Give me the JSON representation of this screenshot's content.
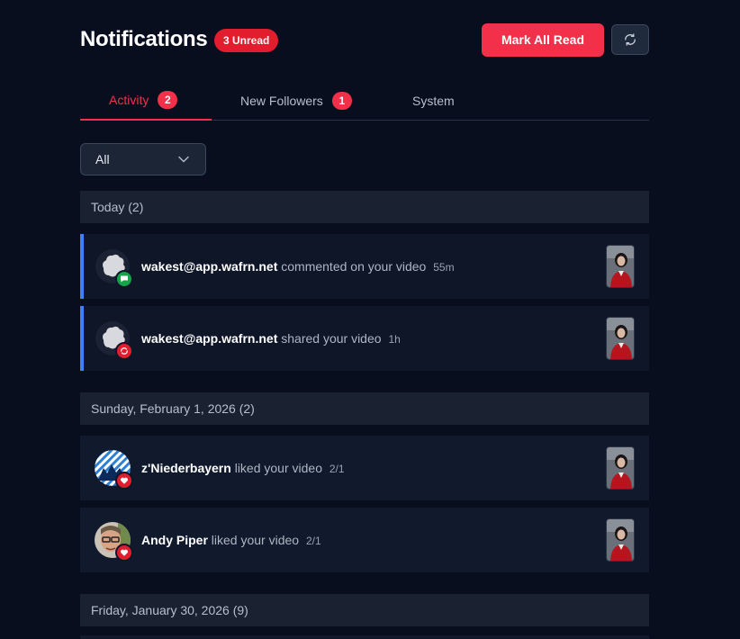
{
  "header": {
    "title": "Notifications",
    "unread_badge": "3 Unread",
    "mark_all_read": "Mark All Read",
    "refresh_icon": "refresh-icon"
  },
  "tabs": [
    {
      "label": "Activity",
      "count": "2",
      "active": true
    },
    {
      "label": "New Followers",
      "count": "1",
      "active": false
    },
    {
      "label": "System",
      "count": "",
      "active": false
    }
  ],
  "filter": {
    "selected": "All",
    "icon": "chevron-down-icon"
  },
  "groups": [
    {
      "label": "Today (2)",
      "items": [
        {
          "actor": "wakest@app.wafrn.net",
          "action": "commented on your video",
          "time": "55m",
          "type": "comment",
          "unread": true
        },
        {
          "actor": "wakest@app.wafrn.net",
          "action": "shared your video",
          "time": "1h",
          "type": "share",
          "unread": true
        }
      ]
    },
    {
      "label": "Sunday, February 1, 2026 (2)",
      "items": [
        {
          "actor": "z'Niederbayern",
          "action": "liked your video",
          "time": "2/1",
          "type": "like",
          "unread": false
        },
        {
          "actor": "Andy Piper",
          "action": "liked your video",
          "time": "2/1",
          "type": "like",
          "unread": false
        }
      ]
    },
    {
      "label": "Friday, January 30, 2026 (9)",
      "items": []
    }
  ],
  "colors": {
    "accent": "#f2304a",
    "unread_border": "#3b82f6",
    "background": "#090e1e"
  }
}
